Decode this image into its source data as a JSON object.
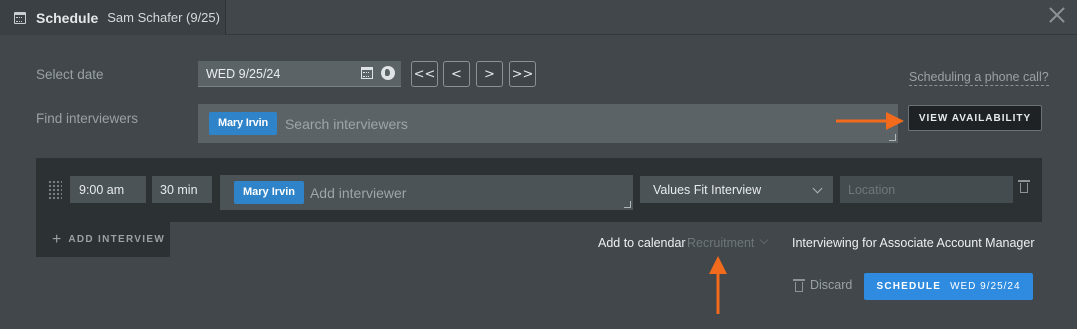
{
  "window": {
    "tab_title": "Schedule",
    "tab_subtitle": "Sam Schafer (9/25)"
  },
  "form": {
    "select_date_label": "Select date",
    "date_value": "WED 9/25/24",
    "nav_buttons": [
      "<<",
      "<",
      ">",
      ">>"
    ],
    "phone_link": "Scheduling a phone call?",
    "find_interviewers_label": "Find interviewers",
    "interviewer_chip": "Mary Irvin",
    "search_placeholder": "Search interviewers",
    "view_availability": "VIEW AVAILABILITY"
  },
  "interview_row": {
    "time": "9:00 am",
    "duration": "30 min",
    "interviewer_chip": "Mary Irvin",
    "add_interviewer_placeholder": "Add interviewer",
    "interview_type": "Values Fit Interview",
    "location_placeholder": "Location"
  },
  "add_interview": "ADD INTERVIEW",
  "calendar": {
    "label": "Add to calendar",
    "value": "Recruitment",
    "interviewing_for": "Interviewing for Associate Account Manager"
  },
  "footer": {
    "discard": "Discard",
    "schedule": "SCHEDULE",
    "schedule_date": "WED 9/25/24"
  },
  "colors": {
    "accent_blue": "#2f8be0",
    "annotation_orange": "#f26a1b",
    "background": "#41474a"
  },
  "icons": [
    "calendar-icon",
    "close-icon",
    "globe-icon",
    "chevron-down-icon",
    "trash-icon",
    "drag-handle-icon",
    "plus-icon"
  ]
}
